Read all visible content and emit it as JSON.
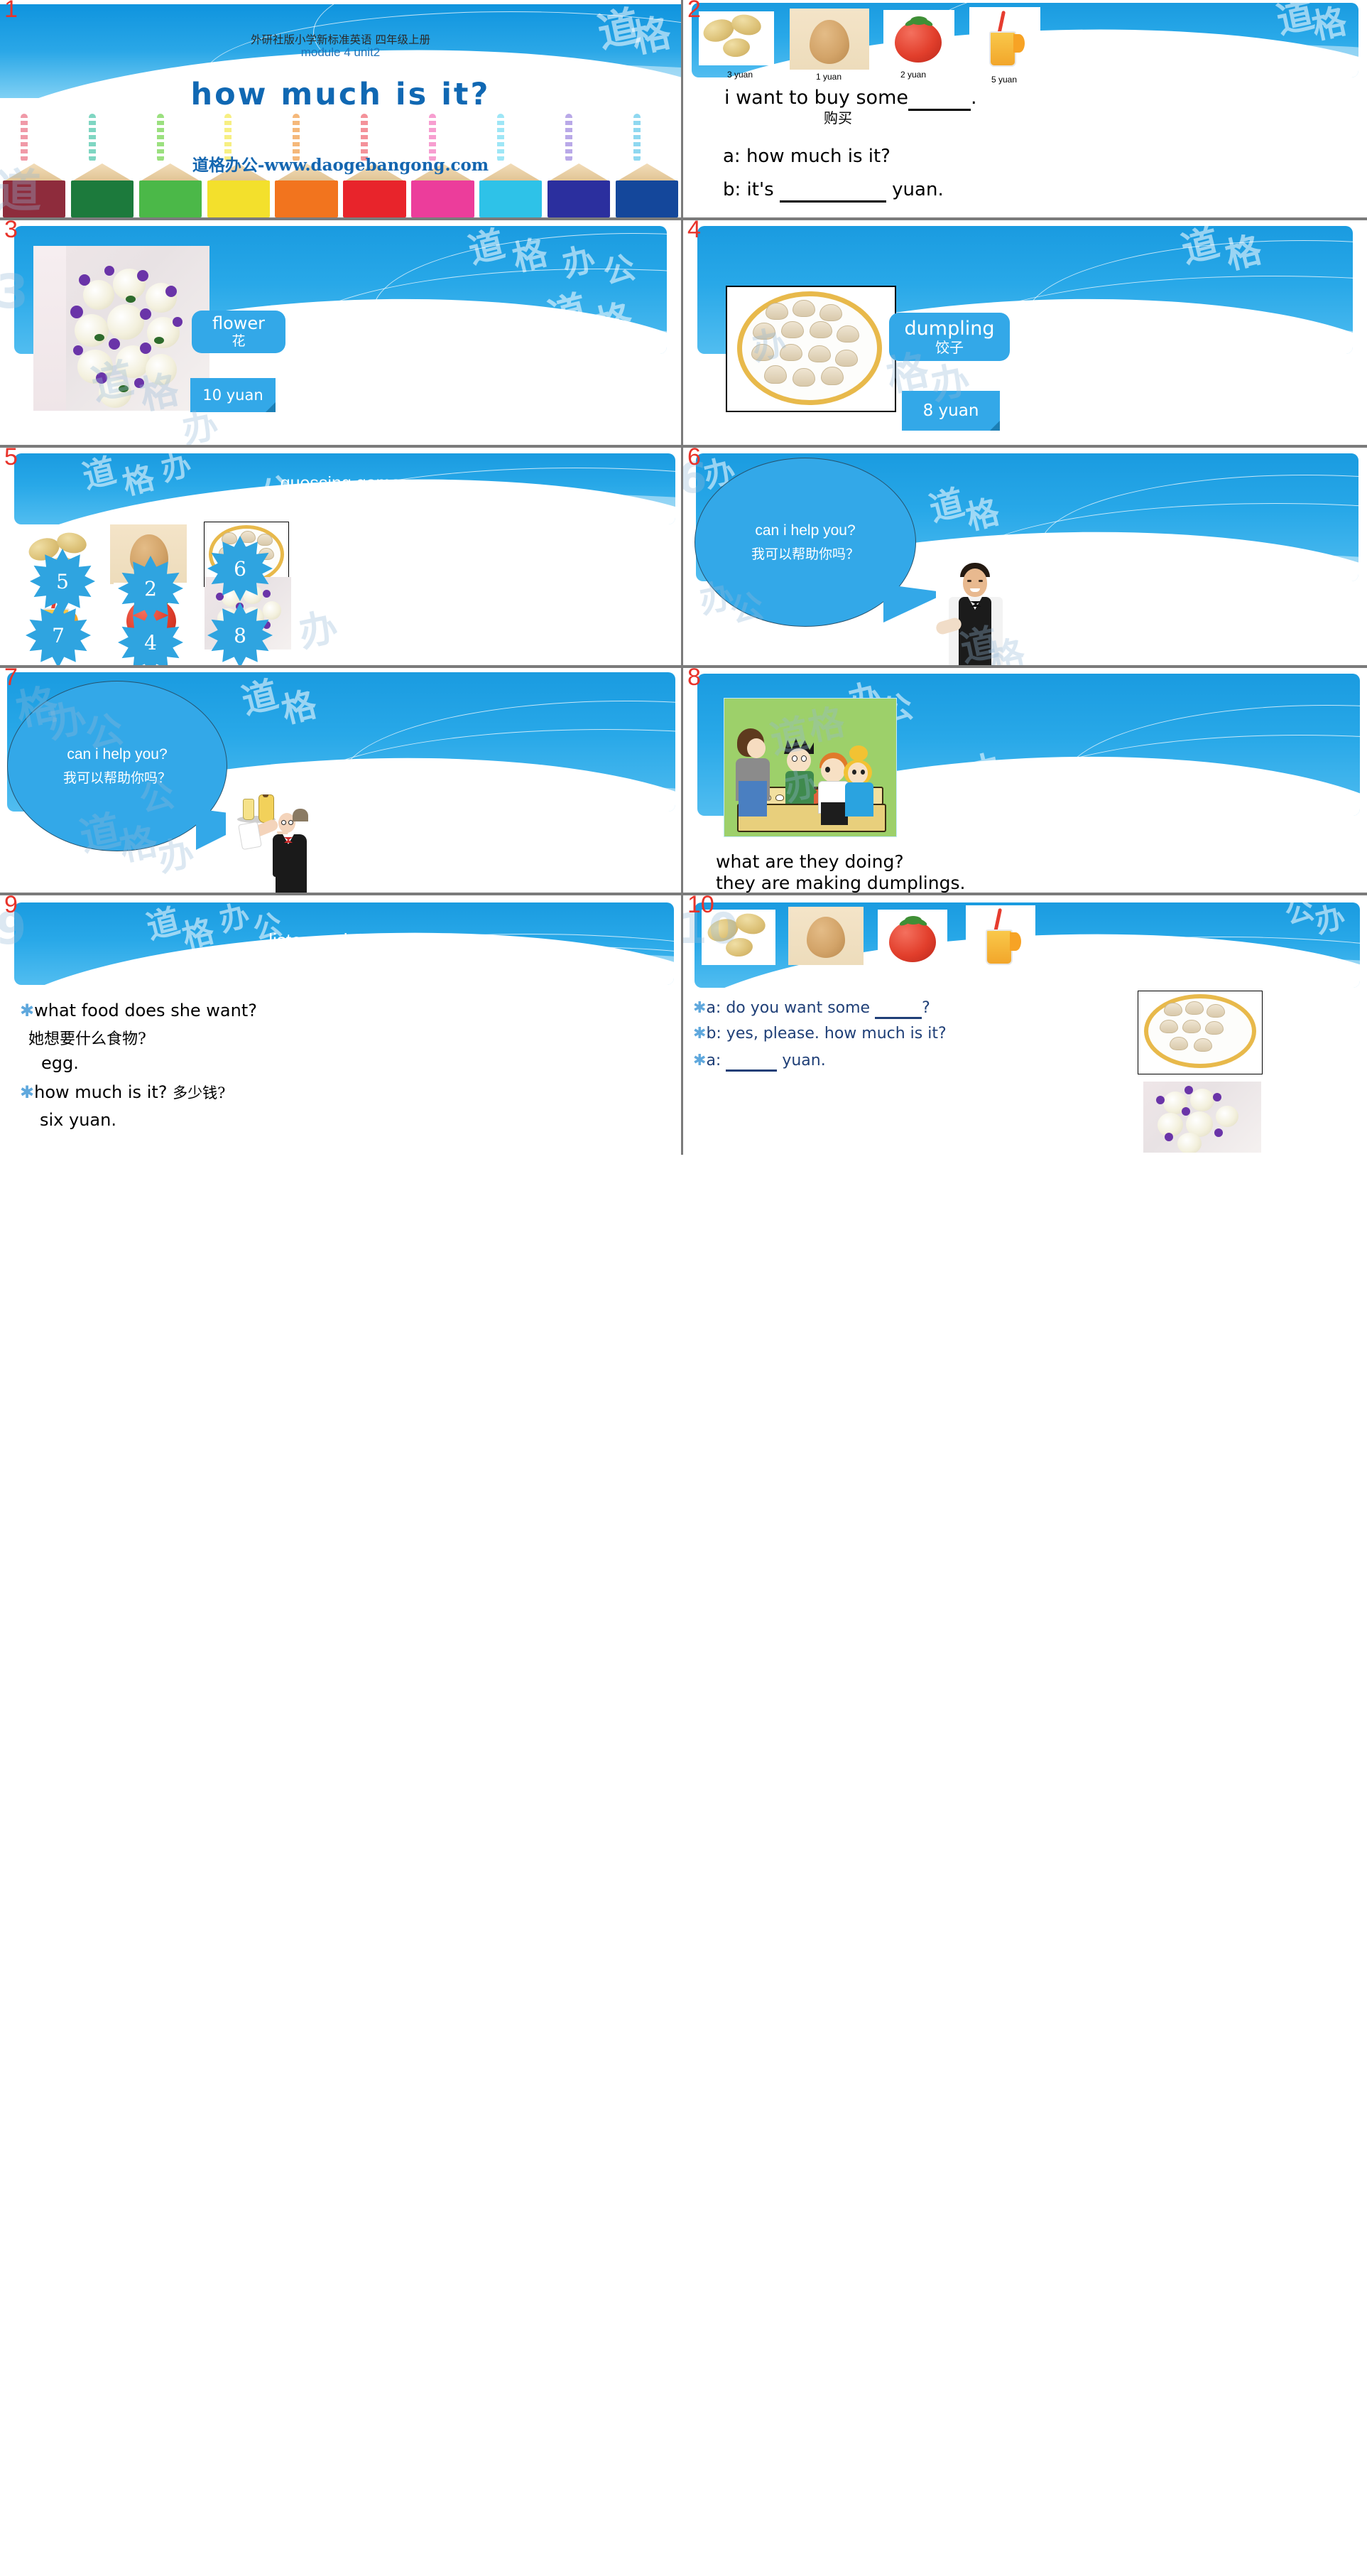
{
  "deck": {
    "slides": [
      {
        "number": "1",
        "subtitle": "外研社版小学新标准英语 四年级上册",
        "module": "module 4 unit2",
        "title": "how much is it?",
        "url": "道格办公-www.daogebangong.com"
      },
      {
        "number": "2",
        "items": [
          {
            "name": "potato",
            "price": "3 yuan"
          },
          {
            "name": "egg",
            "price": "1 yuan"
          },
          {
            "name": "tomato",
            "price": "2 yuan"
          },
          {
            "name": "juice",
            "price": "5 yuan"
          }
        ],
        "line1_a": "i want to  buy  some",
        "line1_b": ".",
        "line1_cn": "购买",
        "line2": "a: how much is it?",
        "line3_a": "b: it's",
        "line3_b": "yuan."
      },
      {
        "number": "3",
        "word": "flower",
        "word_cn": "花",
        "price": "10 yuan",
        "image": "flower-bouquet-photo"
      },
      {
        "number": "4",
        "word": "dumpling",
        "word_cn": "饺子",
        "price": "8 yuan",
        "image": "dumplings-plate-photo"
      },
      {
        "number": "5",
        "title": "guessing game",
        "cards": [
          {
            "image": "potato-photo",
            "value": "5"
          },
          {
            "image": "egg-photo",
            "value": "2"
          },
          {
            "image": "dumplings-photo",
            "value": "6"
          },
          {
            "image": "juice-photo",
            "value": "7"
          },
          {
            "image": "tomato-photo",
            "value": "4"
          },
          {
            "image": "flower-photo",
            "value": "8"
          }
        ]
      },
      {
        "number": "6",
        "bubble_en": "can i help you?",
        "bubble_cn": "我可以帮助你吗？",
        "image": "waiter-man-photo"
      },
      {
        "number": "7",
        "bubble_en": "can i help you?",
        "bubble_cn": "我可以帮助你吗？",
        "image": "cartoon-waiter-photo"
      },
      {
        "number": "8",
        "image": "kids-making-dumplings-cartoon",
        "question": "what are they doing?",
        "answer": "they are making dumplings."
      },
      {
        "number": "9",
        "title": "listen and answer",
        "q1": "what food does she want?",
        "q1_cn": "她想要什么食物?",
        "a1": "egg.",
        "q2_a": "how much is it?",
        "q2_cn": "多少钱?",
        "a2": "six yuan."
      },
      {
        "number": "10",
        "items": [
          "potato-photo",
          "egg-photo",
          "tomato-photo",
          "juice-photo"
        ],
        "line1_a": "a: do you want some",
        "line1_b": "?",
        "line2": "b: yes, please. how much is it?",
        "line3_a": "a:",
        "line3_b": "yuan.",
        "side_images": [
          "dumplings-photo",
          "flower-photo"
        ]
      }
    ]
  },
  "colors": {
    "accent_blue": "#33a8e8",
    "header_blue": "#1a9be0",
    "slide_number_red": "#e8332a",
    "title_blue": "#1068b3",
    "text_dark_blue": "#1f3f77"
  }
}
